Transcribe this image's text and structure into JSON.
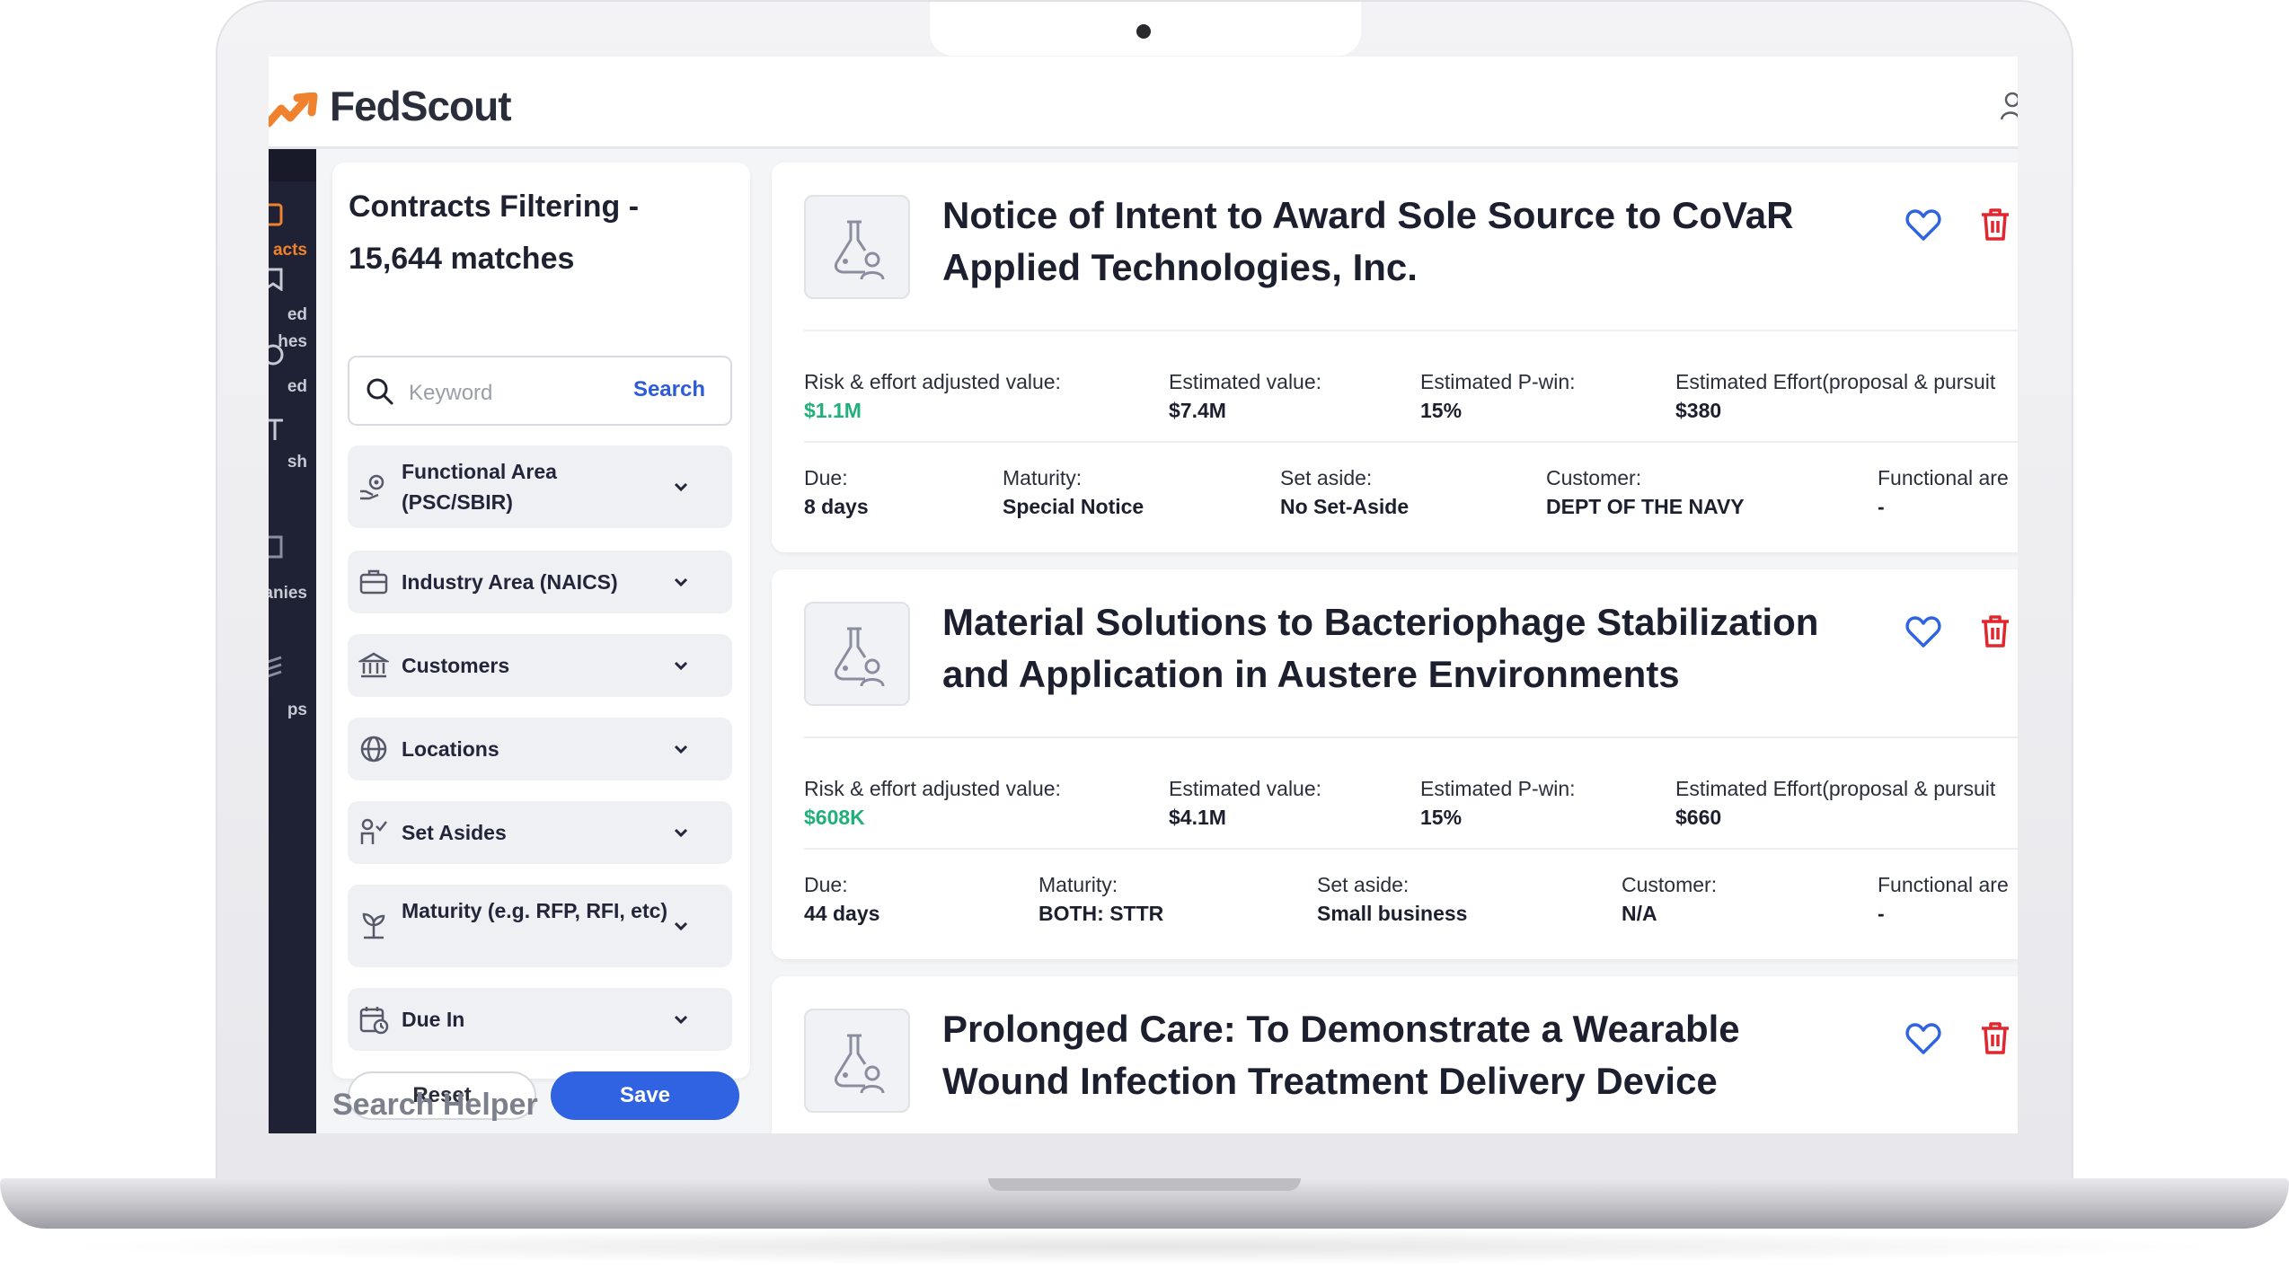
{
  "app": {
    "brand": "FedScout",
    "brand_color": "#f0812d",
    "primary_color": "#2f63e2"
  },
  "sidebar": {
    "items": [
      {
        "label": "acts",
        "icon": "contracts-icon",
        "active": true
      },
      {
        "label": "ed hes",
        "icon": "saved-searches-icon"
      },
      {
        "label": "ed",
        "icon": "tracked-icon"
      },
      {
        "label": "sh",
        "icon": "research-icon"
      },
      {
        "label": "anies",
        "icon": "companies-icon"
      },
      {
        "label": "ps",
        "icon": "groups-icon"
      }
    ]
  },
  "filters": {
    "title": "Contracts Filtering - 15,644 matches",
    "search": {
      "placeholder": "Keyword",
      "button_label": "Search"
    },
    "facets": [
      {
        "label": "Functional Area (PSC/SBIR)",
        "icon": "functional-area-icon"
      },
      {
        "label": "Industry Area (NAICS)",
        "icon": "briefcase-icon"
      },
      {
        "label": "Customers",
        "icon": "government-building-icon"
      },
      {
        "label": "Locations",
        "icon": "globe-icon"
      },
      {
        "label": "Set Asides",
        "icon": "set-asides-icon"
      },
      {
        "label": "Maturity (e.g. RFP, RFI, etc)",
        "icon": "seedling-icon"
      },
      {
        "label": "Due In",
        "icon": "calendar-clock-icon"
      }
    ],
    "reset_label": "Reset",
    "save_label": "Save",
    "helper_title": "Search Helper"
  },
  "contracts": [
    {
      "title": "Notice of Intent to Award Sole Source to CoVaR Applied Technologies, Inc.",
      "risk_label": "Risk & effort adjusted value:",
      "risk_value": "$1.1M",
      "est_value_label": "Estimated value:",
      "est_value": "$7.4M",
      "pwin_label": "Estimated P-win:",
      "pwin": "15%",
      "effort_label": "Estimated Effort(proposal & pursuit",
      "effort": "$380",
      "due_label": "Due:",
      "due": "8 days",
      "maturity_label": "Maturity:",
      "maturity": "Special Notice",
      "setaside_label": "Set aside:",
      "setaside": "No Set-Aside",
      "customer_label": "Customer:",
      "customer": "DEPT OF THE NAVY",
      "functional_label": "Functional are",
      "functional": "-"
    },
    {
      "title": "Material Solutions to Bacteriophage Stabilization and Application in Austere Environments",
      "risk_label": "Risk & effort adjusted value:",
      "risk_value": "$608K",
      "est_value_label": "Estimated value:",
      "est_value": "$4.1M",
      "pwin_label": "Estimated P-win:",
      "pwin": "15%",
      "effort_label": "Estimated Effort(proposal & pursuit",
      "effort": "$660",
      "due_label": "Due:",
      "due": "44 days",
      "maturity_label": "Maturity:",
      "maturity": "BOTH: STTR",
      "setaside_label": "Set aside:",
      "setaside": "Small business",
      "customer_label": "Customer:",
      "customer": "N/A",
      "functional_label": "Functional are",
      "functional": "-"
    },
    {
      "title": "Prolonged Care: To Demonstrate a Wearable Wound Infection Treatment Delivery Device"
    }
  ]
}
